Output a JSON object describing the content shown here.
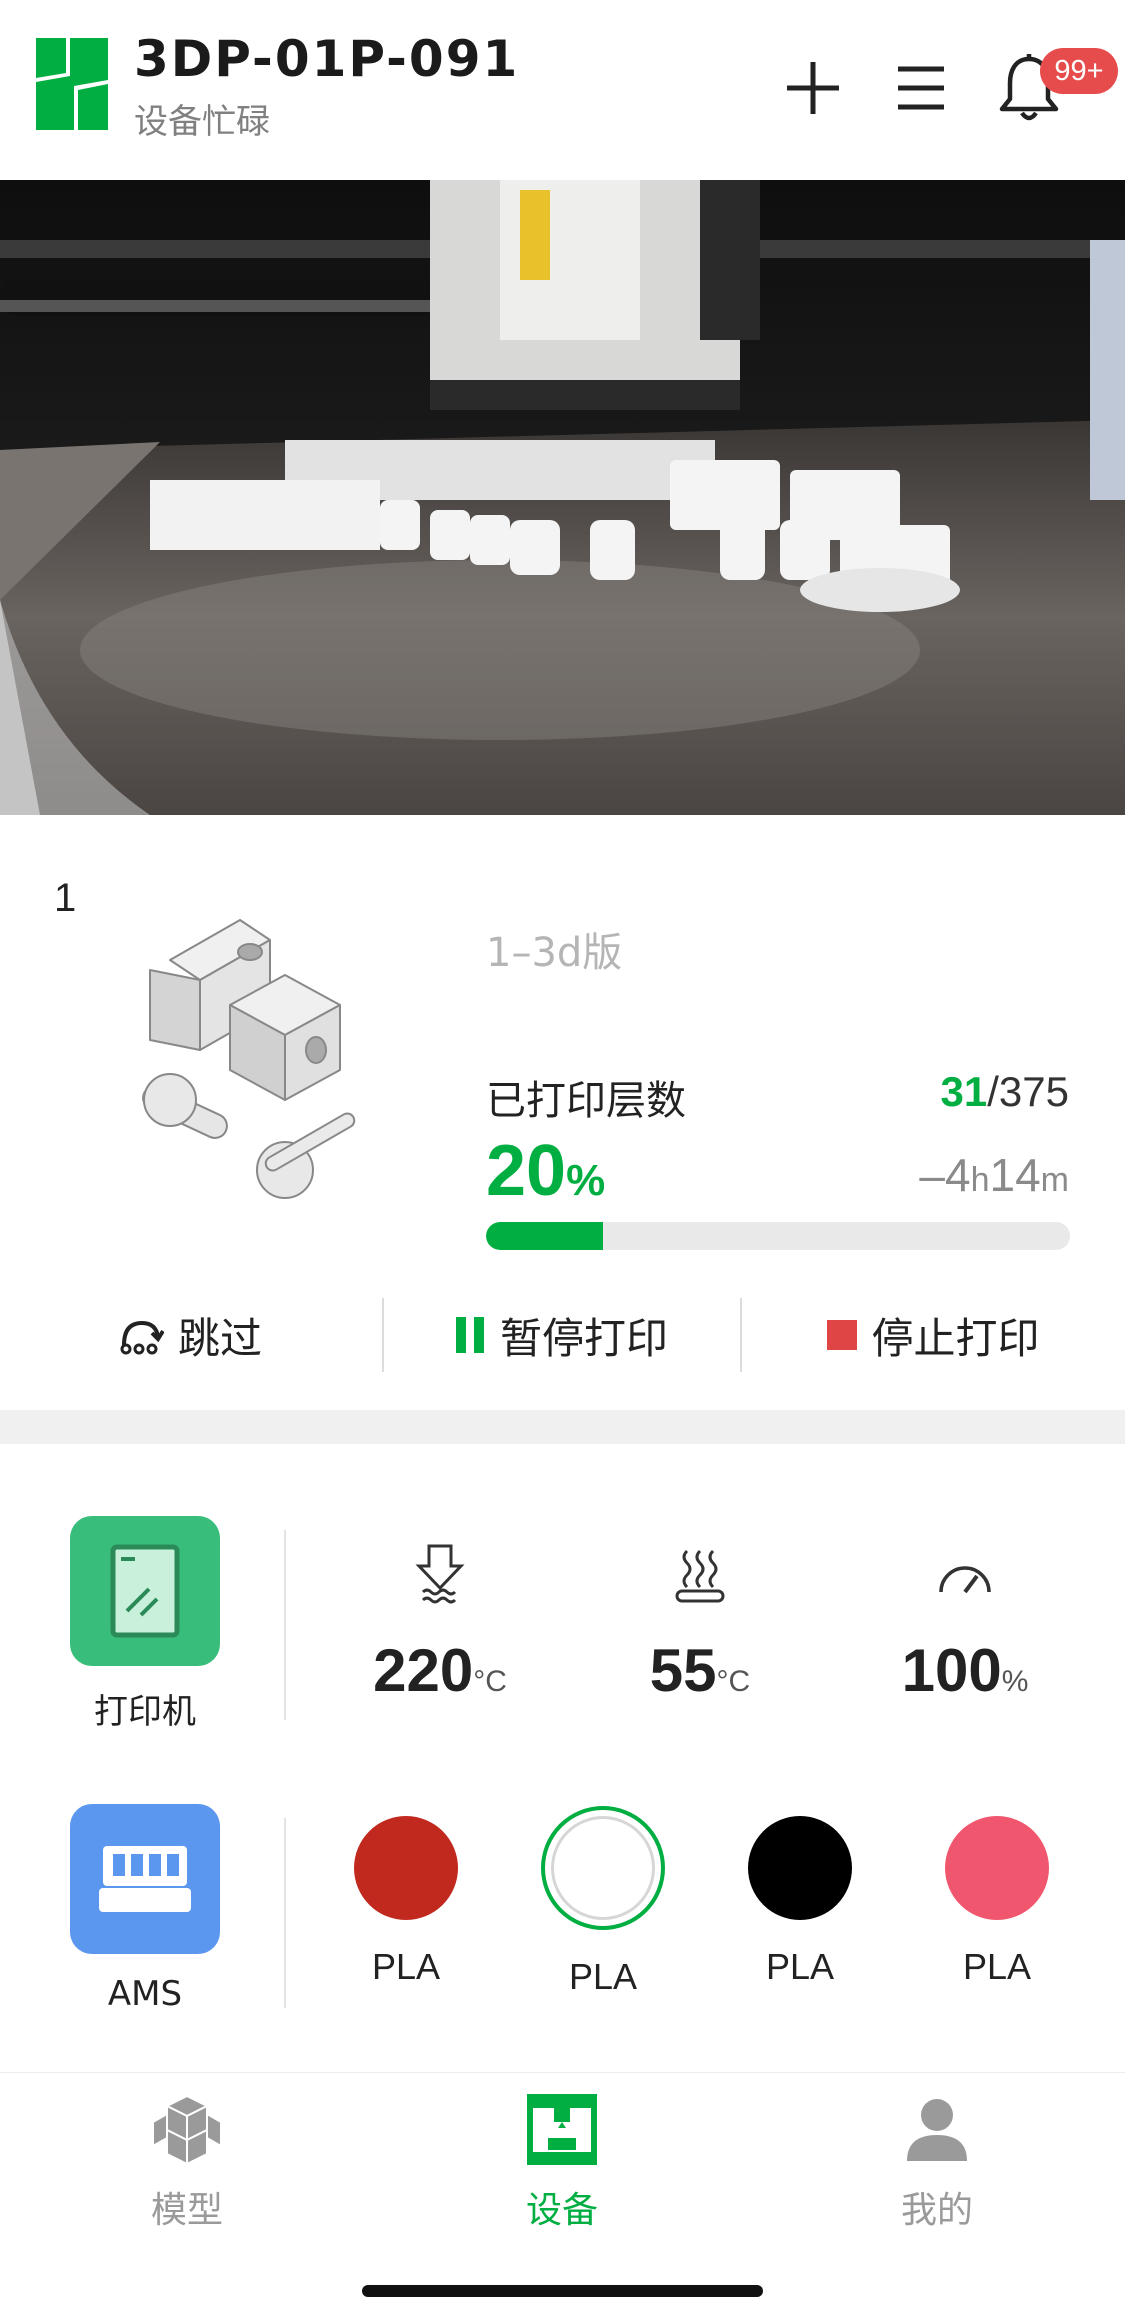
{
  "header": {
    "device_name": "3DP-01P-091",
    "status": "设备忙碌",
    "notification_badge": "99+",
    "icons": [
      "logo-icon",
      "plus-icon",
      "menu-icon",
      "bell-icon"
    ]
  },
  "camera": {
    "description_icon": "camera-feed"
  },
  "job": {
    "index": "1",
    "name": "1–3d版",
    "layers_label": "已打印层数",
    "layers_current": "31",
    "layers_total": "/375",
    "percent_value": "20",
    "percent_unit": "%",
    "progress": 0.2,
    "remaining_prefix": "–4",
    "remaining_h": "h",
    "remaining_min": "14",
    "remaining_m": "m"
  },
  "actions": {
    "skip": "跳过",
    "pause": "暂停打印",
    "stop": "停止打印"
  },
  "printer": {
    "label": "打印机",
    "nozzle_temp": "220",
    "bed_temp": "55",
    "temp_unit": "°C",
    "speed": "100",
    "speed_unit": "%"
  },
  "ams": {
    "label": "AMS",
    "slots": [
      {
        "label": "PLA",
        "color": "#c1281e"
      },
      {
        "label": "PLA",
        "color": "#ffffff"
      },
      {
        "label": "PLA",
        "color": "#000000"
      },
      {
        "label": "PLA",
        "color": "#f0566e"
      }
    ]
  },
  "nav": {
    "models": "模型",
    "devices": "设备",
    "me": "我的"
  },
  "colors": {
    "accent": "#00ae42",
    "stop": "#e04545",
    "printer_tile": "#38bd7a",
    "ams_tile": "#5b97ee",
    "badge": "#e74c4c"
  }
}
